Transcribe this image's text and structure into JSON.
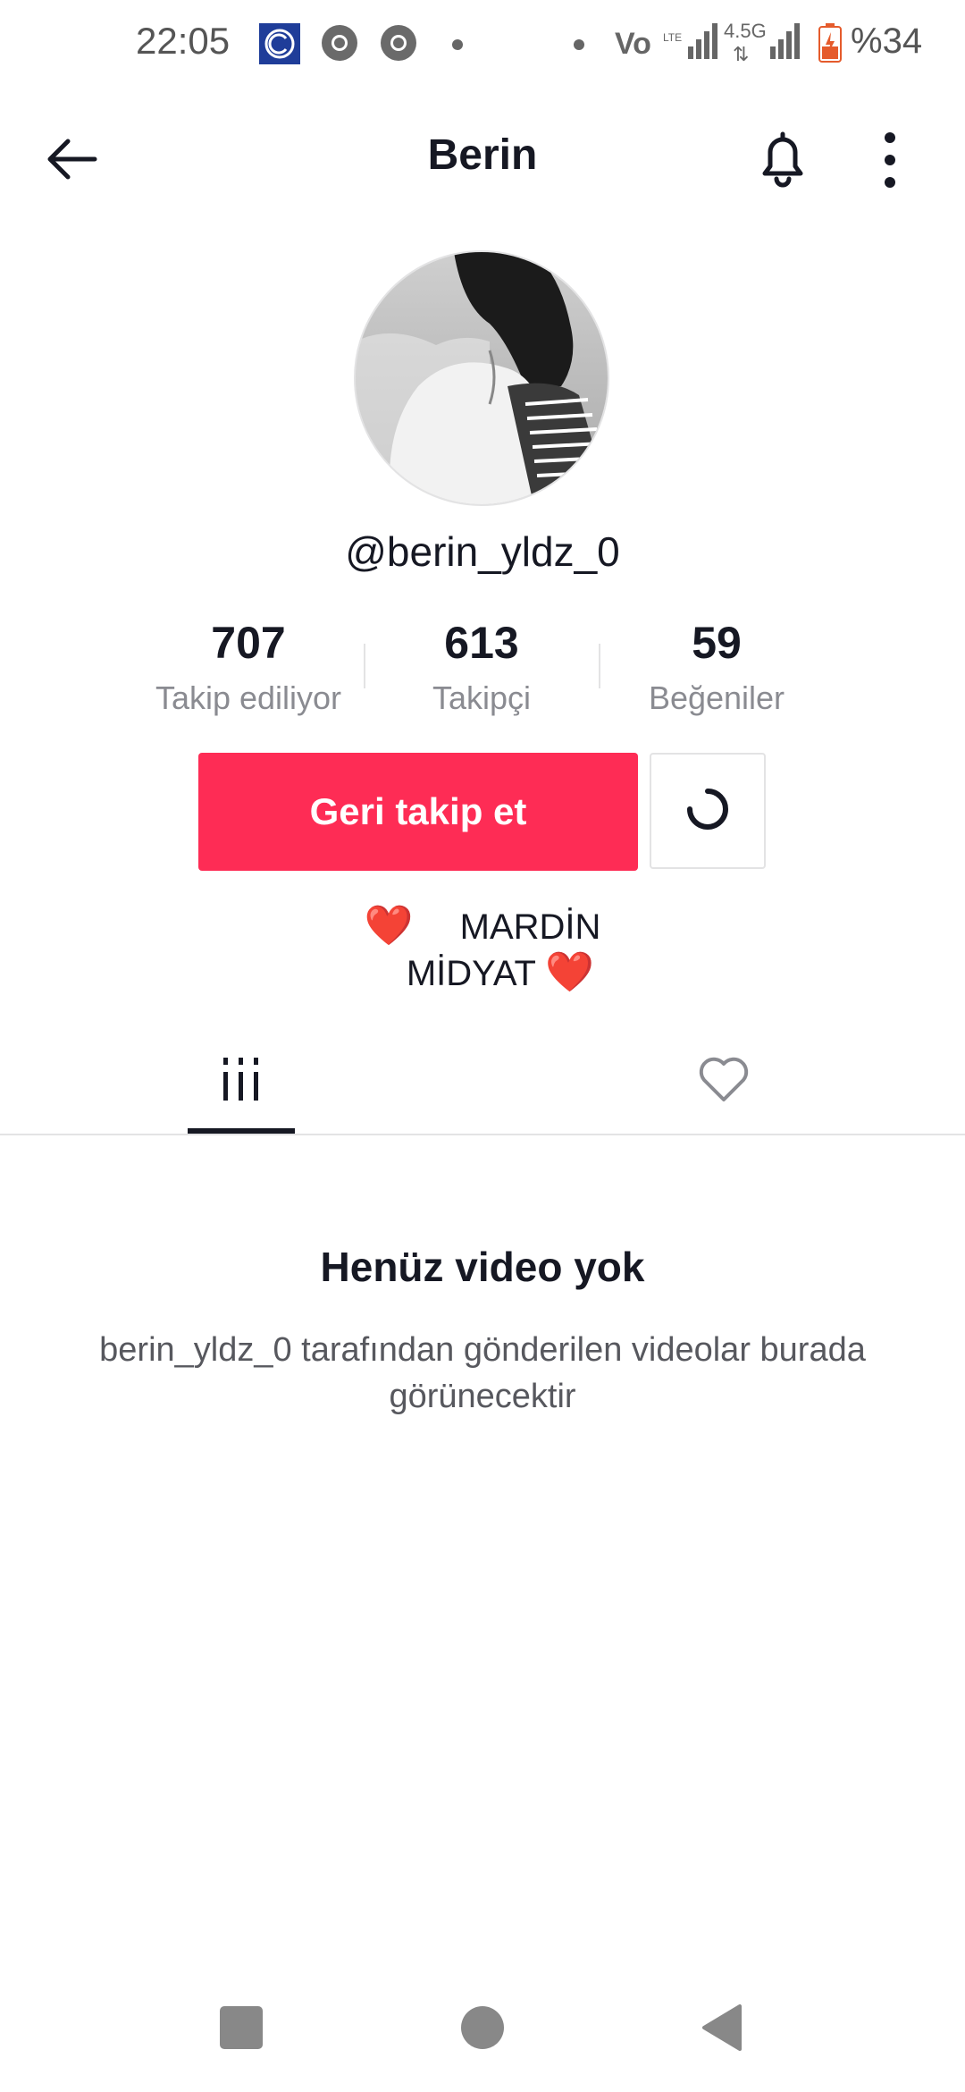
{
  "status_bar": {
    "time": "22:05",
    "network": "4.5G",
    "battery": "%34",
    "icons": [
      "c-app-icon",
      "chrome-icon",
      "chrome-icon",
      "dot",
      "volte-icon",
      "signal-icon",
      "signal-icon",
      "battery-icon"
    ]
  },
  "header": {
    "title": "Berin",
    "icons": [
      "back-arrow-icon",
      "bell-icon",
      "more-vertical-icon"
    ]
  },
  "profile": {
    "username": "@berin_yldz_0",
    "stats": [
      {
        "value": "707",
        "label": "Takip ediliyor"
      },
      {
        "value": "613",
        "label": "Takipçi"
      },
      {
        "value": "59",
        "label": "Beğeniler"
      }
    ],
    "follow_button": "Geri takip et",
    "bio_line1_heart": "❤️",
    "bio_line1_text": "MARDİN",
    "bio_line2_text": "MİDYAT",
    "bio_line2_heart": "❤️"
  },
  "tabs": [
    {
      "name": "videos",
      "icon": "grid-icon",
      "active": true
    },
    {
      "name": "liked",
      "icon": "heart-outline-icon",
      "active": false
    }
  ],
  "empty_state": {
    "title": "Henüz video yok",
    "description": "berin_yldz_0 tarafından gönderilen videolar burada görünecektir"
  },
  "colors": {
    "accent": "#fe2c55",
    "text": "#161823",
    "secondary_text": "#8a8b91",
    "divider": "#e3e3e4"
  }
}
